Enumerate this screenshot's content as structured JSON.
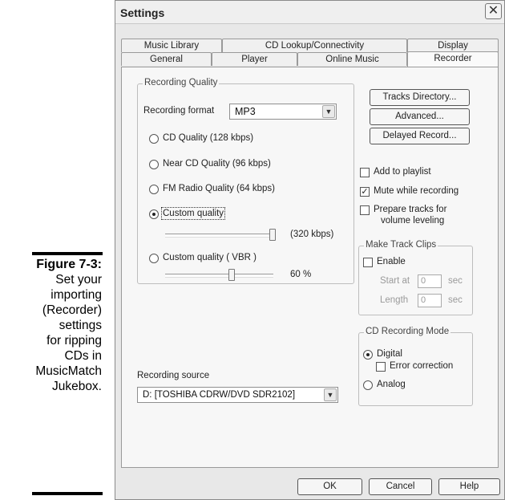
{
  "caption": {
    "figure_label": "Figure 7-3:",
    "lines": [
      "Set your",
      "importing",
      "(Recorder)",
      "settings",
      "for ripping",
      "CDs in",
      "MusicMatch",
      "Jukebox."
    ]
  },
  "dialog": {
    "title": "Settings",
    "close_glyph": "✕"
  },
  "tabs": {
    "row1": [
      "Music Library",
      "CD Lookup/Connectivity",
      "Display"
    ],
    "row2": [
      "General",
      "Player",
      "Online Music",
      "Recorder"
    ],
    "active": "Recorder"
  },
  "recording_quality": {
    "group_label": "Recording Quality",
    "format_label": "Recording format",
    "format_value": "MP3",
    "options": [
      {
        "label": "CD Quality (128 kbps)",
        "selected": false
      },
      {
        "label": "Near CD Quality (96 kbps)",
        "selected": false
      },
      {
        "label": "FM Radio Quality (64 kbps)",
        "selected": false
      },
      {
        "label": "Custom quality",
        "selected": true
      },
      {
        "label": "Custom quality ( VBR )",
        "selected": false
      }
    ],
    "custom_value": "(320 kbps)",
    "vbr_value": "60 %",
    "custom_slider_level": 1.0,
    "vbr_slider_level": 0.6
  },
  "buttons": {
    "tracks_directory": "Tracks Directory...",
    "advanced": "Advanced...",
    "delayed_record": "Delayed Record..."
  },
  "checks": {
    "add_to_playlist": {
      "label": "Add to playlist",
      "checked": false
    },
    "mute_while_recording": {
      "label": "Mute while recording",
      "checked": true
    },
    "prepare_tracks": {
      "label_line1": "Prepare tracks for",
      "label_line2": "volume leveling",
      "checked": false
    }
  },
  "make_track_clips": {
    "group_label": "Make Track Clips",
    "enable_label": "Enable",
    "enabled": false,
    "start_label": "Start at",
    "start_value": "0",
    "length_label": "Length",
    "length_value": "0",
    "unit": "sec"
  },
  "cd_recording_mode": {
    "group_label": "CD Recording Mode",
    "digital_label": "Digital",
    "digital_selected": true,
    "error_correction_label": "Error correction",
    "error_correction_checked": false,
    "analog_label": "Analog",
    "analog_selected": false
  },
  "recording_source": {
    "label": "Recording source",
    "value": "D: [TOSHIBA CDRW/DVD SDR2102]"
  },
  "footer": {
    "ok": "OK",
    "cancel": "Cancel",
    "help": "Help"
  }
}
